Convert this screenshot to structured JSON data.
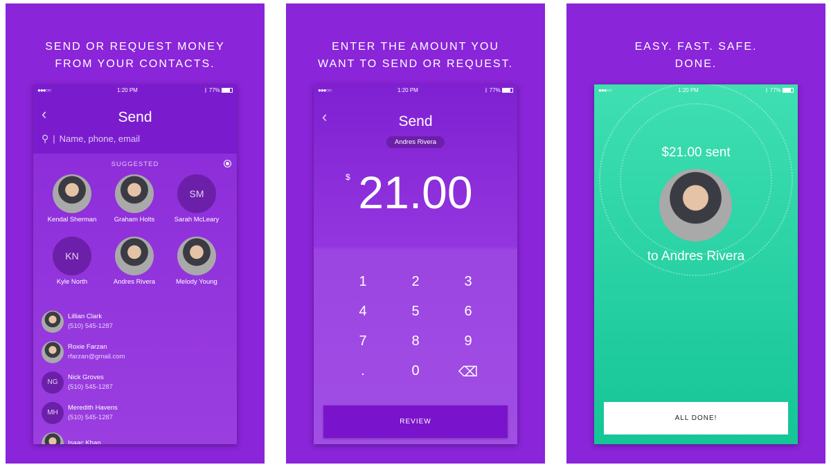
{
  "colors": {
    "panel": "#8a25d9",
    "phone_purple": "#7e1ed0",
    "success_green": "#2fd3a4"
  },
  "panels": [
    {
      "caption": [
        "SEND OR REQUEST MONEY",
        "FROM YOUR CONTACTS."
      ]
    },
    {
      "caption": [
        "ENTER THE AMOUNT YOU",
        "WANT TO SEND OR REQUEST."
      ]
    },
    {
      "caption": [
        "EASY. FAST. SAFE.",
        "DONE."
      ]
    }
  ],
  "status": {
    "time": "1:20 PM",
    "battery": "77%",
    "signal": "●●●○○"
  },
  "screen1": {
    "title": "Send",
    "search_placeholder": "Name, phone, email",
    "section": "SUGGESTED",
    "suggested": [
      {
        "name": "Kendal Sherman",
        "initials": ""
      },
      {
        "name": "Graham Holts",
        "initials": ""
      },
      {
        "name": "Sarah McLeary",
        "initials": "SM"
      },
      {
        "name": "Kyle North",
        "initials": "KN"
      },
      {
        "name": "Andres Rivera",
        "initials": ""
      },
      {
        "name": "Melody Young",
        "initials": ""
      }
    ],
    "contacts": [
      {
        "name": "Lillian Clark",
        "detail": "(510) 545-1287",
        "initials": ""
      },
      {
        "name": "Roxie Farzan",
        "detail": "rfarzan@gmail.com",
        "initials": ""
      },
      {
        "name": "Nick Groves",
        "detail": "(510) 545-1287",
        "initials": "NG"
      },
      {
        "name": "Meredith Havens",
        "detail": "(510) 545-1287",
        "initials": "MH"
      },
      {
        "name": "Isaac Khan",
        "detail": "",
        "initials": ""
      }
    ]
  },
  "screen2": {
    "title": "Send",
    "recipient": "Andres Rivera",
    "currency": "$",
    "amount": "21.00",
    "keys": [
      "1",
      "2",
      "3",
      "4",
      "5",
      "6",
      "7",
      "8",
      "9",
      ".",
      "0",
      "⌫"
    ],
    "review": "REVIEW"
  },
  "screen3": {
    "sent": "$21.00 sent",
    "to": "to Andres Rivera",
    "done": "ALL DONE!"
  }
}
